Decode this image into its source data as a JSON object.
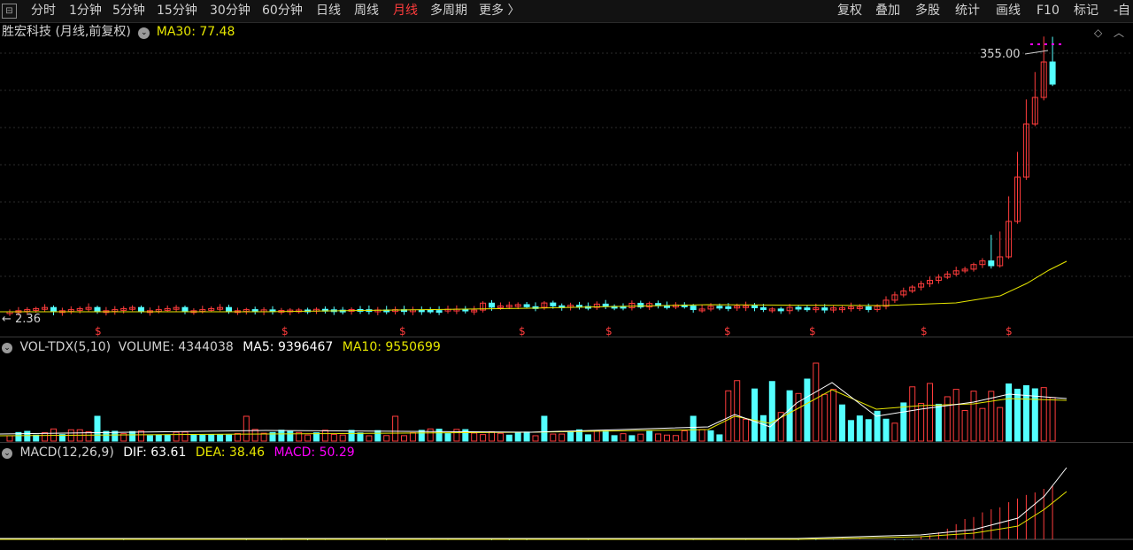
{
  "toolbar": {
    "menu_icon": "menu-icon",
    "periods": [
      "分时",
      "1分钟",
      "5分钟",
      "15分钟",
      "30分钟",
      "60分钟",
      "日线",
      "周线",
      "月线",
      "多周期",
      "更多 〉"
    ],
    "active_period": "月线",
    "tools": [
      "复权",
      "叠加",
      "多股",
      "统计",
      "画线",
      "F10",
      "标记",
      "-自"
    ]
  },
  "price_panel": {
    "title": "胜宏科技 (月线,前复权)",
    "indicator_label": "MA30: 77.48",
    "high_marker": "355.00",
    "low_marker": "← 2.36",
    "event_marker": "$"
  },
  "volume_panel": {
    "name": "VOL-TDX(5,10)",
    "volume": "VOLUME: 4344038",
    "ma5": "MA5: 9396467",
    "ma10": "MA10: 9550699"
  },
  "macd_panel": {
    "name": "MACD(12,26,9)",
    "dif": "DIF: 63.61",
    "dea": "DEA: 38.46",
    "macd": "MACD: 50.29"
  },
  "colors": {
    "up": "#ff3c3c",
    "down": "#54ffff",
    "ma_line": "#e6e600",
    "ma5_line": "#ffffff",
    "macd_magenta": "#ff00ff",
    "active_tab": "#ff3c3c"
  },
  "chart_data": {
    "type": "candlestick",
    "period": "monthly",
    "price_ylim": [
      0,
      360
    ],
    "high": 355.0,
    "low": 2.36,
    "last_ma30": 77.48,
    "series": [
      {
        "name": "VOLUME",
        "last": 4344038
      },
      {
        "name": "MA5",
        "last": 9396467
      },
      {
        "name": "MA10",
        "last": 9550699
      },
      {
        "name": "DIF",
        "last": 63.61
      },
      {
        "name": "DEA",
        "last": 38.46
      },
      {
        "name": "MACD",
        "last": 50.29
      }
    ]
  }
}
